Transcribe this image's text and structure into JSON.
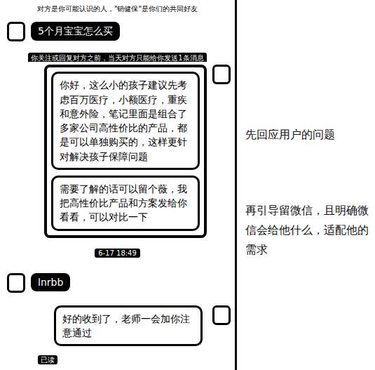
{
  "chat": {
    "items": [
      {
        "kind": "system",
        "text": "对方是你可能认识的人，\"销健保\"是你们的共同好友"
      },
      {
        "kind": "incoming",
        "text": "5个月宝宝怎么买"
      },
      {
        "kind": "system-dark",
        "text": "你关注或回复对方之前，当天对方只能给你发送1条消息"
      },
      {
        "kind": "outgoing",
        "highlighted": true,
        "bubbles": [
          "你好，这么小的孩子建议先考虑百万医疗，小额医疗，重疾和意外险，笔记里面是组合了多家公司高性价比的产品，都是可以单独购买的，这样更针对解决孩子保障问题",
          "需要了解的话可以留个薇，我把高性价比产品和方案发给你看看，可以对比一下"
        ]
      },
      {
        "kind": "time",
        "text": "6-17 18:49"
      },
      {
        "kind": "incoming",
        "text": "lnrbb"
      },
      {
        "kind": "outgoing",
        "highlighted": false,
        "bubbles": [
          "好的收到了，老师一会加你注意通过"
        ]
      },
      {
        "kind": "read",
        "text": "已读"
      }
    ]
  },
  "annotations": [
    {
      "text": "先回应用户的问题"
    },
    {
      "text": "再引导留微信，且明确微信会给他什么，适配他的需求"
    }
  ]
}
